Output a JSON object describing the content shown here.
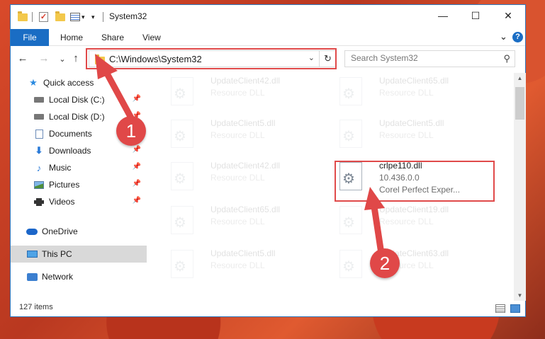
{
  "window": {
    "title": "System32",
    "minimize_glyph": "—",
    "maximize_glyph": "☐",
    "close_glyph": "✕"
  },
  "ribbon": {
    "file_tab": "File",
    "tabs": [
      "Home",
      "Share",
      "View"
    ],
    "expand_glyph": "⌄",
    "help_glyph": "?"
  },
  "address_bar": {
    "path": "C:\\Windows\\System32",
    "dropdown_glyph": "⌄",
    "refresh_glyph": "↻"
  },
  "nav_buttons": {
    "back": "←",
    "forward": "→",
    "recent": "⌄",
    "up": "↑"
  },
  "search": {
    "placeholder": "Search System32",
    "icon": "⚲"
  },
  "sidebar": {
    "items": [
      {
        "label": "Quick access",
        "icon": "star-icon",
        "pinned": false
      },
      {
        "label": "Local Disk (C:)",
        "icon": "drive-icon",
        "pinned": true
      },
      {
        "label": "Local Disk (D:)",
        "icon": "drive-icon",
        "pinned": true
      },
      {
        "label": "Documents",
        "icon": "documents-icon",
        "pinned": true
      },
      {
        "label": "Downloads",
        "icon": "downloads-icon",
        "pinned": true
      },
      {
        "label": "Music",
        "icon": "music-icon",
        "pinned": true
      },
      {
        "label": "Pictures",
        "icon": "pictures-icon",
        "pinned": true
      },
      {
        "label": "Videos",
        "icon": "videos-icon",
        "pinned": true
      },
      {
        "label": "OneDrive",
        "icon": "onedrive-icon",
        "pinned": false
      },
      {
        "label": "This PC",
        "icon": "this-pc-icon",
        "pinned": false,
        "selected": true
      },
      {
        "label": "Network",
        "icon": "network-icon",
        "pinned": false
      }
    ]
  },
  "files": [
    {
      "name": "UpdateClient42.dll",
      "line2": "Resource DLL",
      "line3": "",
      "faded": true
    },
    {
      "name": "UpdateClient65.dll",
      "line2": "Resource DLL",
      "line3": "",
      "faded": true
    },
    {
      "name": "UpdateClient5.dll",
      "line2": "Resource DLL",
      "line3": "",
      "faded": true
    },
    {
      "name": "UpdateClient5.dll",
      "line2": "Resource DLL",
      "line3": "",
      "faded": true
    },
    {
      "name": "UpdateClient42.dll",
      "line2": "Resource DLL",
      "line3": "",
      "faded": true
    },
    {
      "name": "crlpe110.dll",
      "line2": "10.436.0.0",
      "line3": "Corel Perfect Exper...",
      "faded": false
    },
    {
      "name": "UpdateClient65.dll",
      "line2": "Resource DLL",
      "line3": "",
      "faded": true
    },
    {
      "name": "UpdateClient19.dll",
      "line2": "Resource DLL",
      "line3": "",
      "faded": true
    },
    {
      "name": "UpdateClient5.dll",
      "line2": "Resource DLL",
      "line3": "",
      "faded": true
    },
    {
      "name": "UpdateClient63.dll",
      "line2": "Resource DLL",
      "line3": "",
      "faded": true
    }
  ],
  "status_bar": {
    "item_count": "127 items"
  },
  "annotations": {
    "step1": "1",
    "step2": "2",
    "color": "#e04848"
  },
  "colors": {
    "accent": "#1a6dc4",
    "highlight": "#e04a4a",
    "selected_nav": "#d9d9d9"
  }
}
